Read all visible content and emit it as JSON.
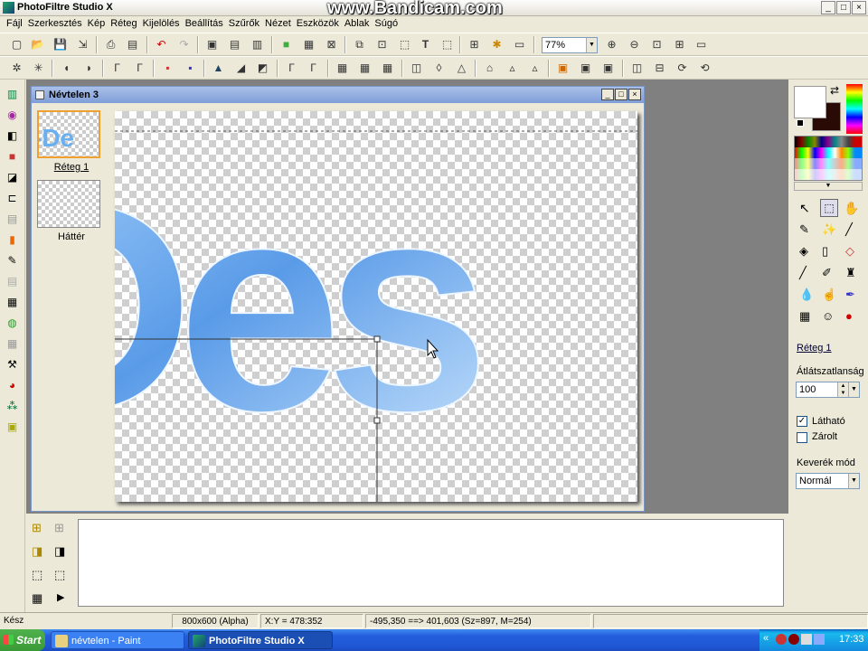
{
  "window": {
    "title": "PhotoFiltre Studio X",
    "watermark": "www.Bandicam.com",
    "buttons": [
      "_",
      "□",
      "×"
    ]
  },
  "menu": [
    "Fájl",
    "Szerkesztés",
    "Kép",
    "Réteg",
    "Kijelölés",
    "Beállítás",
    "Szűrők",
    "Nézet",
    "Eszközök",
    "Ablak",
    "Súgó"
  ],
  "toolbar": {
    "zoom": "77%"
  },
  "document": {
    "title": "Névtelen 3",
    "text": "Des"
  },
  "layers": [
    {
      "label": "Réteg 1",
      "selected": true
    },
    {
      "label": "Háttér",
      "selected": false
    }
  ],
  "right_panel": {
    "layer_name": "Réteg 1",
    "opacity_label": "Átlátszatlanság",
    "opacity_value": "100",
    "visible_label": "Látható",
    "visible_checked": true,
    "locked_label": "Zárolt",
    "locked_checked": false,
    "blend_label": "Keverék mód",
    "blend_value": "Normál"
  },
  "status": {
    "state": "Kész",
    "size": "800x600 (Alpha)",
    "coords": "X:Y = 478:352",
    "selection": "-495,350 ==> 401,603 (Sz=897, M=254)"
  },
  "taskbar": {
    "start": "Start",
    "tasks": [
      {
        "label": "névtelen - Paint",
        "active": false
      },
      {
        "label": "PhotoFiltre Studio X",
        "active": true
      }
    ],
    "clock": "17:33"
  },
  "colors": {
    "accent": "#316ac5",
    "text_fill": "#5a9be8"
  }
}
